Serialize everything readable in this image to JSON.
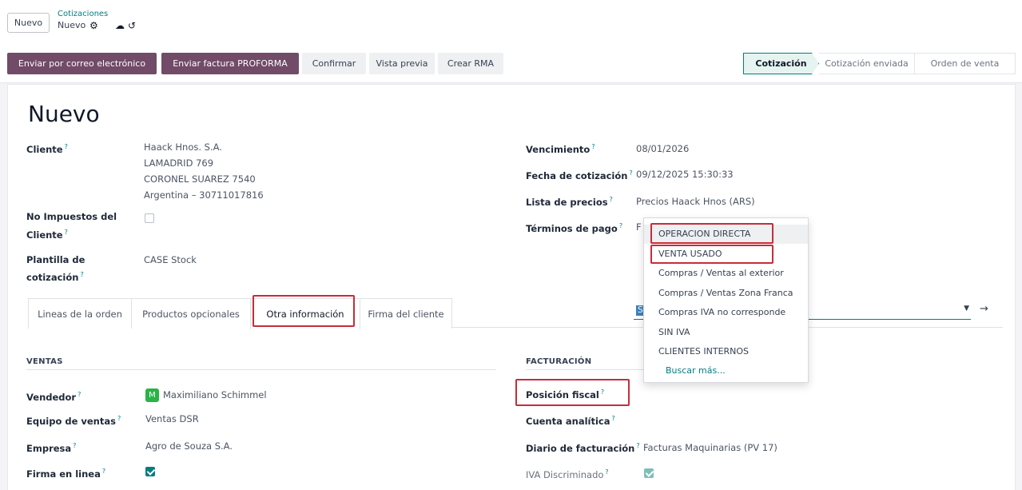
{
  "breadcrumb": {
    "new_button": "Nuevo",
    "parent": "Cotizaciones",
    "current": "Nuevo",
    "icons": [
      "gear-icon",
      "cloud-upload-icon",
      "undo-icon"
    ]
  },
  "actions": {
    "send_email": "Enviar por correo electrónico",
    "send_proforma": "Enviar factura PROFORMA",
    "confirm": "Confirmar",
    "preview": "Vista previa",
    "create_rma": "Crear RMA"
  },
  "statusbar": [
    "Cotización",
    "Cotización enviada",
    "Orden de venta"
  ],
  "record": {
    "title": "Nuevo"
  },
  "left_fields": {
    "customer_label": "Cliente",
    "customer": [
      "Haack Hnos. S.A.",
      "LAMADRID 769",
      "CORONEL SUAREZ 7540",
      "Argentina – 30711017816"
    ],
    "no_tax_label_1": "No Impuestos del",
    "no_tax_label_2": "Cliente",
    "template_label_1": "Plantilla de",
    "template_label_2": "cotización",
    "template": "CASE Stock"
  },
  "right_fields": {
    "due_label": "Vencimiento",
    "due": "08/01/2026",
    "quote_date_label": "Fecha de cotización",
    "quote_date": "09/12/2025 15:30:33",
    "pricelist_label": "Lista de precios",
    "pricelist": "Precios Haack Hnos (ARS)",
    "payment_terms_label": "Términos de pago",
    "payment_terms": "F"
  },
  "tabs": [
    "Lineas de la orden",
    "Productos opcionales",
    "Otra información",
    "Firma del cliente"
  ],
  "sales": {
    "heading": "VENTAS",
    "salesperson_label": "Vendedor",
    "salesperson_initial": "M",
    "salesperson": "Maximiliano Schimmel",
    "team_label": "Equipo de ventas",
    "team": "Ventas DSR",
    "company_label": "Empresa",
    "company": "Agro de Souza S.A.",
    "online_sign_label": "Firma en linea"
  },
  "invoicing": {
    "heading": "FACTURACIÓN",
    "fiscal_label": "Posición fiscal",
    "fiscal_value": "SIN IVA",
    "analytic_label": "Cuenta analítica",
    "journal_label": "Diario de facturación",
    "journal": "Facturas Maquinarias (PV 17)",
    "vat_label": "IVA Discriminado"
  },
  "dropdown": {
    "items": [
      "OPERACION DIRECTA",
      "VENTA USADO",
      "Compras / Ventas al exterior",
      "Compras / Ventas Zona Franca",
      "Compras IVA no corresponde",
      "SIN IVA",
      "CLIENTES INTERNOS"
    ],
    "more": "Buscar más..."
  },
  "colors": {
    "primary": "#714b67",
    "accent": "#017e84",
    "highlight": "#c62d3a"
  }
}
